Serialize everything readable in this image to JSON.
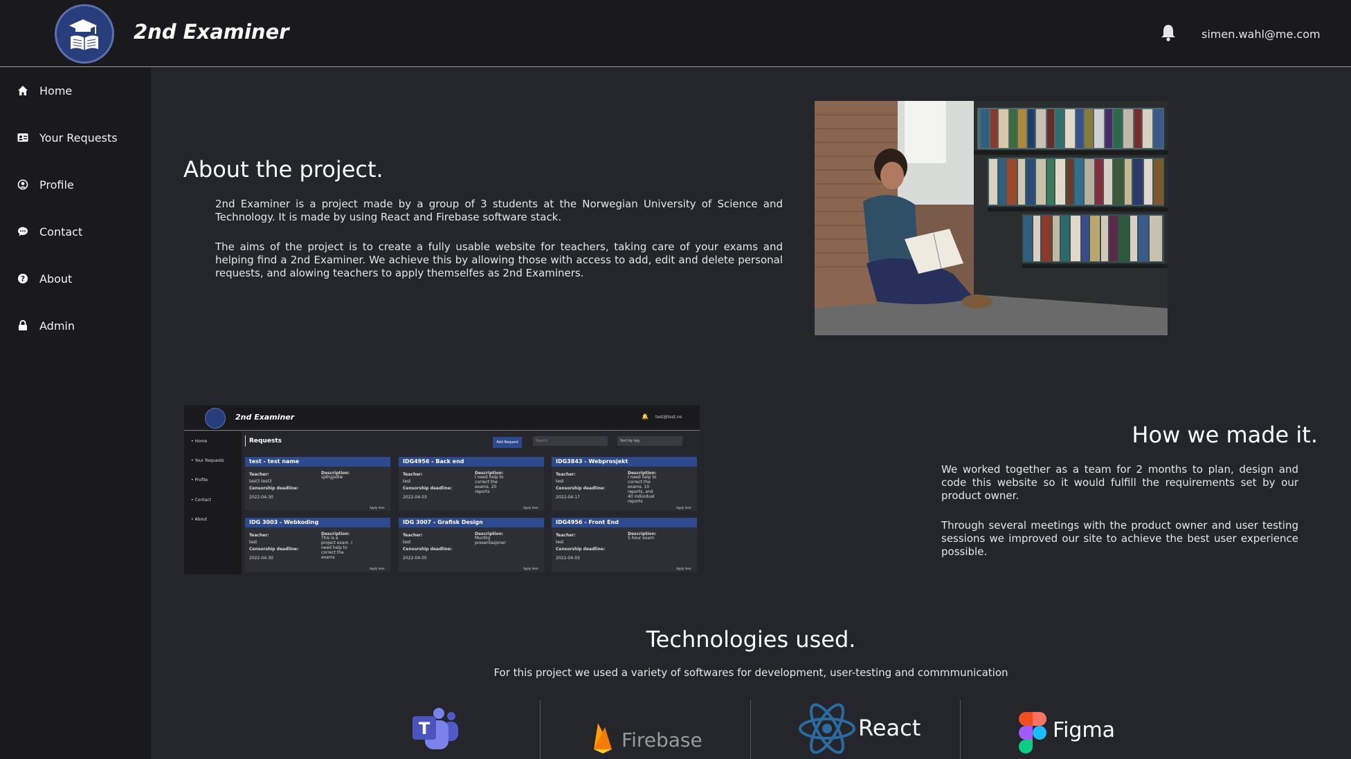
{
  "header": {
    "app_title": "2nd Examiner",
    "user_email": "simen.wahl@me.com",
    "icons": [
      "graduation-logo",
      "bell-icon"
    ]
  },
  "sidebar": {
    "items": [
      {
        "label": "Home",
        "icon": "home-icon"
      },
      {
        "label": "Your Requests",
        "icon": "id-card-icon"
      },
      {
        "label": "Profile",
        "icon": "user-circle-icon"
      },
      {
        "label": "Contact",
        "icon": "chat-icon"
      },
      {
        "label": "About",
        "icon": "question-icon"
      },
      {
        "label": "Admin",
        "icon": "lock-icon"
      }
    ]
  },
  "about": {
    "heading": "About the project.",
    "para1": "2nd Examiner is a project made by a group of 3 students at the Norwegian University of Science and Technology. It is made by using React and Firebase software stack.",
    "para2": "The aims of the project is to create a fully usable website for teachers, taking care of your exams and helping find a 2nd Examiner. We achieve this by allowing those with access to add, edit and delete personal requests, and alowing teachers to apply themselfes as 2nd Examiners."
  },
  "screenshot": {
    "app_title": "2nd Examiner",
    "email": "test@test.no",
    "page_title": "Requests",
    "add_request": "Add Request",
    "search": "Search",
    "sort": "Sort by tag",
    "nav": [
      "Home",
      "Your Requests",
      "Profile",
      "Contact",
      "About"
    ],
    "cards": [
      {
        "title": "test - test name",
        "teacher": "test3 test3",
        "description": "sjdhgjsdlw",
        "deadline": "2022-04-30"
      },
      {
        "title": "IDG4956 - Back end",
        "teacher": "test",
        "description": "I need help to correct the exams. 20 reports",
        "deadline": "2022-04-03"
      },
      {
        "title": "IDG3843 - Webprosjekt",
        "teacher": "test",
        "description": "I need help to correct the exams. 10 reports, and 40 individual reports",
        "deadline": "2022-04-17"
      },
      {
        "title": "IDG 3003 - Webkoding",
        "teacher": "test",
        "description": "This is a project exam. I need help to correct the exams",
        "deadline": "2022-04-30"
      },
      {
        "title": "IDG 3007 - Grafisk Design",
        "teacher": "test",
        "description": "Muntlig presentasjoner",
        "deadline": "2022-04-05"
      },
      {
        "title": "IDG4956 - Front End",
        "teacher": "test",
        "description": "5 hour exam",
        "deadline": "2022-04-03"
      }
    ],
    "labels": {
      "teacher": "Teacher:",
      "description": "Description:",
      "deadline": "Censorship deadline:",
      "apply": "Apply here"
    }
  },
  "how": {
    "heading": "How we made it.",
    "para1": "We worked together as a team for 2 months to plan, design and code this website so it would fulfill the requirements set by our product owner.",
    "para2": "Through several meetings with the product owner and user testing sessions we improved our site to achieve the best user experience possible."
  },
  "tech": {
    "heading": "Technologies used.",
    "subtitle": "For this project we used a variety of softwares for development, user-testing and commmunication",
    "logos": [
      {
        "name": "Teams",
        "icon": "teams-logo"
      },
      {
        "name": "Firebase",
        "icon": "firebase-logo"
      },
      {
        "name": "React",
        "icon": "react-logo"
      },
      {
        "name": "Figma",
        "icon": "figma-logo"
      }
    ]
  }
}
